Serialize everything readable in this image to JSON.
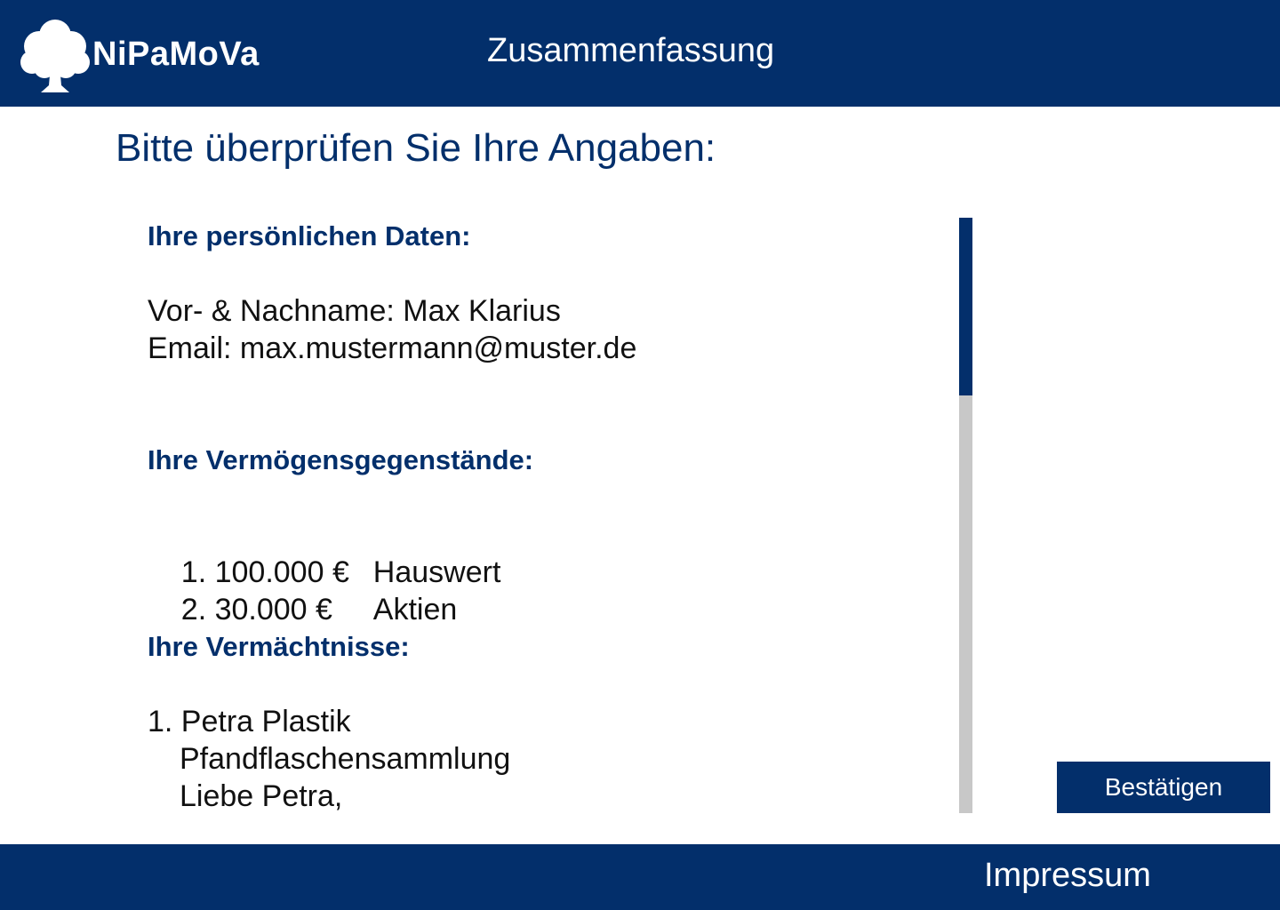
{
  "header": {
    "logo_text": "NiPaMoVa",
    "logo_icon": "tree-icon",
    "title": "Zusammenfassung"
  },
  "page": {
    "heading": "Bitte überprüfen Sie Ihre Angaben:"
  },
  "personal": {
    "title": "Ihre persönlichen Daten:",
    "name_line": "Vor- & Nachname: Max Klarius",
    "email_line": "Email: max.mustermann@muster.de"
  },
  "assets": {
    "title": "Ihre Vermögensgegenstände:",
    "items": [
      {
        "amount": "1. 100.000 €",
        "label": "Hauswert"
      },
      {
        "amount": "2. 30.000 €",
        "label": "Aktien"
      }
    ]
  },
  "legacies": {
    "title": "Ihre Vermächtnisse:",
    "items": [
      {
        "recipient": "1. Petra Plastik",
        "item": "Pfandflaschensammlung",
        "message": "Liebe Petra,"
      }
    ]
  },
  "actions": {
    "confirm_label": "Bestätigen"
  },
  "footer": {
    "impressum_label": "Impressum"
  },
  "colors": {
    "primary": "#032f6b",
    "scroll_track": "#c8c8c8",
    "text": "#111111"
  }
}
